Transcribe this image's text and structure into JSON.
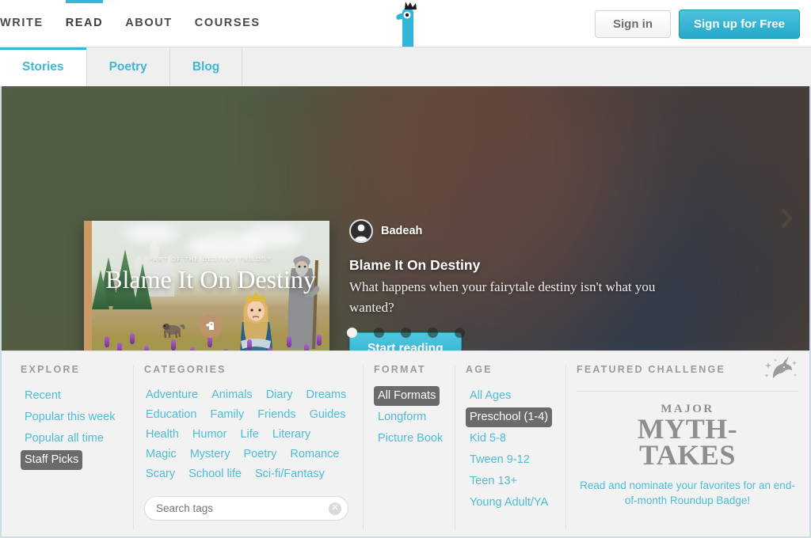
{
  "header": {
    "nav": [
      {
        "label": "WRITE",
        "active": false
      },
      {
        "label": "READ",
        "active": true
      },
      {
        "label": "ABOUT",
        "active": false
      },
      {
        "label": "COURSES",
        "active": false
      }
    ],
    "logo_icon": "bird-with-crown-logo",
    "signin_label": "Sign in",
    "signup_label": "Sign up for Free",
    "accent_color": "#30bad6"
  },
  "tabs": [
    {
      "label": "Stories",
      "active": true
    },
    {
      "label": "Poetry",
      "active": false
    },
    {
      "label": "Blog",
      "active": false
    }
  ],
  "hero": {
    "author": "Badeah",
    "avatar_icon": "user-avatar-icon",
    "title": "Blame It On Destiny",
    "description": "What happens when your fairytale destiny isn't what you wanted?",
    "cta_label": "Start reading",
    "next_icon": "chevron-right-icon",
    "cover": {
      "kicker": "PART OF THE DESTINY TRILOGY",
      "title": "Blame It On Destiny",
      "badge_icon": "bird-badge-icon"
    },
    "carousel": {
      "total": 5,
      "active_index": 0
    }
  },
  "filters": {
    "explore": {
      "heading": "EXPLORE",
      "items": [
        {
          "label": "Recent",
          "selected": false
        },
        {
          "label": "Popular this week",
          "selected": false
        },
        {
          "label": "Popular all time",
          "selected": false
        },
        {
          "label": "Staff Picks",
          "selected": true
        }
      ]
    },
    "categories": {
      "heading": "CATEGORIES",
      "items": [
        {
          "label": "Adventure",
          "selected": false
        },
        {
          "label": "Animals",
          "selected": false
        },
        {
          "label": "Diary",
          "selected": false
        },
        {
          "label": "Dreams",
          "selected": false
        },
        {
          "label": "Education",
          "selected": false
        },
        {
          "label": "Family",
          "selected": false
        },
        {
          "label": "Friends",
          "selected": false
        },
        {
          "label": "Guides",
          "selected": false
        },
        {
          "label": "Health",
          "selected": false
        },
        {
          "label": "Humor",
          "selected": false
        },
        {
          "label": "Life",
          "selected": false
        },
        {
          "label": "Literary",
          "selected": false
        },
        {
          "label": "Magic",
          "selected": false
        },
        {
          "label": "Mystery",
          "selected": false
        },
        {
          "label": "Poetry",
          "selected": false
        },
        {
          "label": "Romance",
          "selected": false
        },
        {
          "label": "Scary",
          "selected": false
        },
        {
          "label": "School life",
          "selected": false
        },
        {
          "label": "Sci-fi/Fantasy",
          "selected": false
        }
      ],
      "search_placeholder": "Search tags",
      "search_value": "",
      "clear_icon": "clear-x-icon"
    },
    "format": {
      "heading": "FORMAT",
      "items": [
        {
          "label": "All Formats",
          "selected": true
        },
        {
          "label": "Longform",
          "selected": false
        },
        {
          "label": "Picture Book",
          "selected": false
        }
      ]
    },
    "age": {
      "heading": "AGE",
      "items": [
        {
          "label": "All Ages",
          "selected": false
        },
        {
          "label": "Preschool (1-4)",
          "selected": true
        },
        {
          "label": "Kid 5-8",
          "selected": false
        },
        {
          "label": "Tween 9-12",
          "selected": false
        },
        {
          "label": "Teen 13+",
          "selected": false
        },
        {
          "label": "Young Adult/YA",
          "selected": false
        }
      ]
    },
    "challenge": {
      "heading": "FEATURED CHALLENGE",
      "icon": "unicorn-sparkle-icon",
      "title_line1": "MAJOR",
      "title_line2": "MYTH-",
      "title_line3": "TAKES",
      "subtitle": "Read and nominate your favorites for an end-of-month Roundup Badge!"
    }
  }
}
